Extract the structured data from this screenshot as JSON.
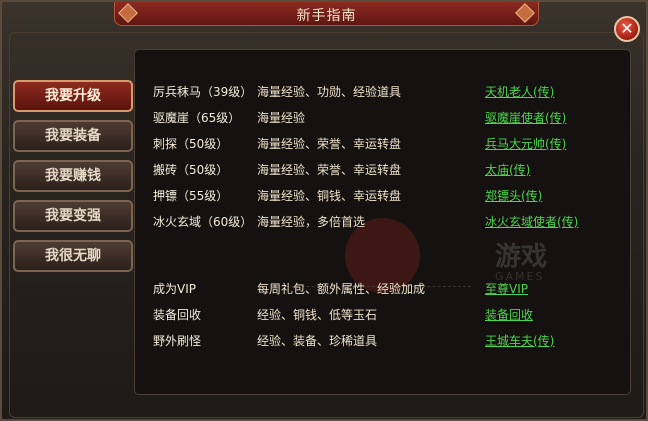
{
  "window": {
    "title": "新手指南",
    "close_symbol": "✕"
  },
  "sidebar": {
    "items": [
      {
        "label": "我要升级",
        "active": true
      },
      {
        "label": "我要装备",
        "active": false
      },
      {
        "label": "我要赚钱",
        "active": false
      },
      {
        "label": "我要变强",
        "active": false
      },
      {
        "label": "我很无聊",
        "active": false
      }
    ]
  },
  "watermark": {
    "text": "游戏",
    "sub": "GAMES"
  },
  "guide": {
    "upgrade_rows": [
      {
        "name": "厉兵秣马（39级）",
        "reward": "海量经验、功勋、经验道具",
        "link": "天机老人(传)"
      },
      {
        "name": "驱魔崖（65级）",
        "reward": "海量经验",
        "link": "驱魔崖使者(传)"
      },
      {
        "name": "刺探（50级）",
        "reward": "海量经验、荣誉、幸运转盘",
        "link": "兵马大元帅(传)"
      },
      {
        "name": "搬砖（50级）",
        "reward": "海量经验、荣誉、幸运转盘",
        "link": "太庙(传)"
      },
      {
        "name": "押镖（55级）",
        "reward": "海量经验、铜钱、幸运转盘",
        "link": "郑镖头(传)"
      },
      {
        "name": "冰火玄域（60级）",
        "reward": "海量经验，多倍首选",
        "link": "冰火玄域使者(传)"
      }
    ],
    "other_rows": [
      {
        "name": "成为VIP",
        "reward": "每周礼包、额外属性、经验加成",
        "link": "至尊VIP"
      },
      {
        "name": "装备回收",
        "reward": "经验、铜钱、低等玉石",
        "link": "装备回收"
      },
      {
        "name": "野外刷怪",
        "reward": "经验、装备、珍稀道具",
        "link": "王城车夫(传)"
      }
    ]
  }
}
